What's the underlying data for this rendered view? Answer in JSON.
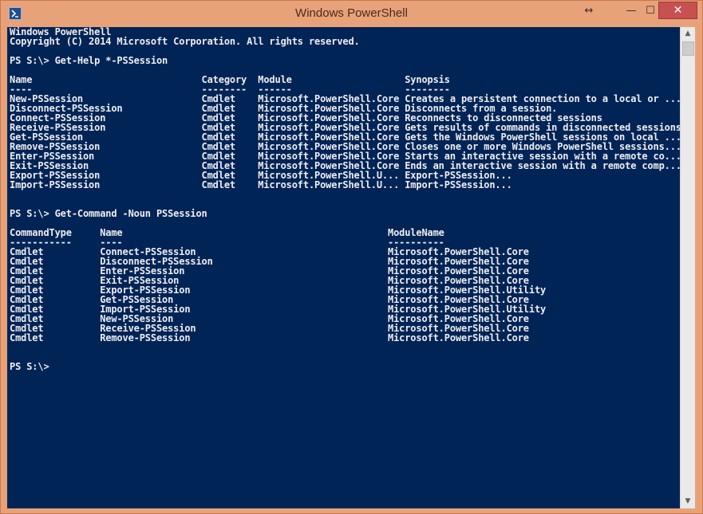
{
  "window": {
    "title": "Windows PowerShell",
    "resize_glyph": "↔",
    "minimize_glyph": "—",
    "maximize_glyph": "☐",
    "close_glyph": "✕"
  },
  "colors": {
    "console_bg": "#012456",
    "console_fg": "#eeedf0",
    "titlebar": "#e8a27a",
    "close_button": "#c75050"
  },
  "console": {
    "lines": [
      "Windows PowerShell",
      "Copyright (C) 2014 Microsoft Corporation. All rights reserved.",
      "",
      "PS S:\\> Get-Help *-PSSession",
      "",
      "Name                              Category  Module                    Synopsis",
      "----                              --------  ------                    --------",
      "New-PSSession                     Cmdlet    Microsoft.PowerShell.Core Creates a persistent connection to a local or ...",
      "Disconnect-PSSession              Cmdlet    Microsoft.PowerShell.Core Disconnects from a session.",
      "Connect-PSSession                 Cmdlet    Microsoft.PowerShell.Core Reconnects to disconnected sessions",
      "Receive-PSSession                 Cmdlet    Microsoft.PowerShell.Core Gets results of commands in disconnected sessions",
      "Get-PSSession                     Cmdlet    Microsoft.PowerShell.Core Gets the Windows PowerShell sessions on local ...",
      "Remove-PSSession                  Cmdlet    Microsoft.PowerShell.Core Closes one or more Windows PowerShell sessions...",
      "Enter-PSSession                   Cmdlet    Microsoft.PowerShell.Core Starts an interactive session with a remote co...",
      "Exit-PSSession                    Cmdlet    Microsoft.PowerShell.Core Ends an interactive session with a remote comp...",
      "Export-PSSession                  Cmdlet    Microsoft.PowerShell.U... Export-PSSession...",
      "Import-PSSession                  Cmdlet    Microsoft.PowerShell.U... Import-PSSession...",
      "",
      "",
      "PS S:\\> Get-Command -Noun PSSession",
      "",
      "CommandType     Name                                               ModuleName",
      "-----------     ----                                               ----------",
      "Cmdlet          Connect-PSSession                                  Microsoft.PowerShell.Core",
      "Cmdlet          Disconnect-PSSession                               Microsoft.PowerShell.Core",
      "Cmdlet          Enter-PSSession                                    Microsoft.PowerShell.Core",
      "Cmdlet          Exit-PSSession                                     Microsoft.PowerShell.Core",
      "Cmdlet          Export-PSSession                                   Microsoft.PowerShell.Utility",
      "Cmdlet          Get-PSSession                                      Microsoft.PowerShell.Core",
      "Cmdlet          Import-PSSession                                   Microsoft.PowerShell.Utility",
      "Cmdlet          New-PSSession                                      Microsoft.PowerShell.Core",
      "Cmdlet          Receive-PSSession                                  Microsoft.PowerShell.Core",
      "Cmdlet          Remove-PSSession                                   Microsoft.PowerShell.Core",
      "",
      "",
      "PS S:\\>"
    ]
  },
  "scrollbar": {
    "up_glyph": "▲",
    "down_glyph": "▼"
  }
}
